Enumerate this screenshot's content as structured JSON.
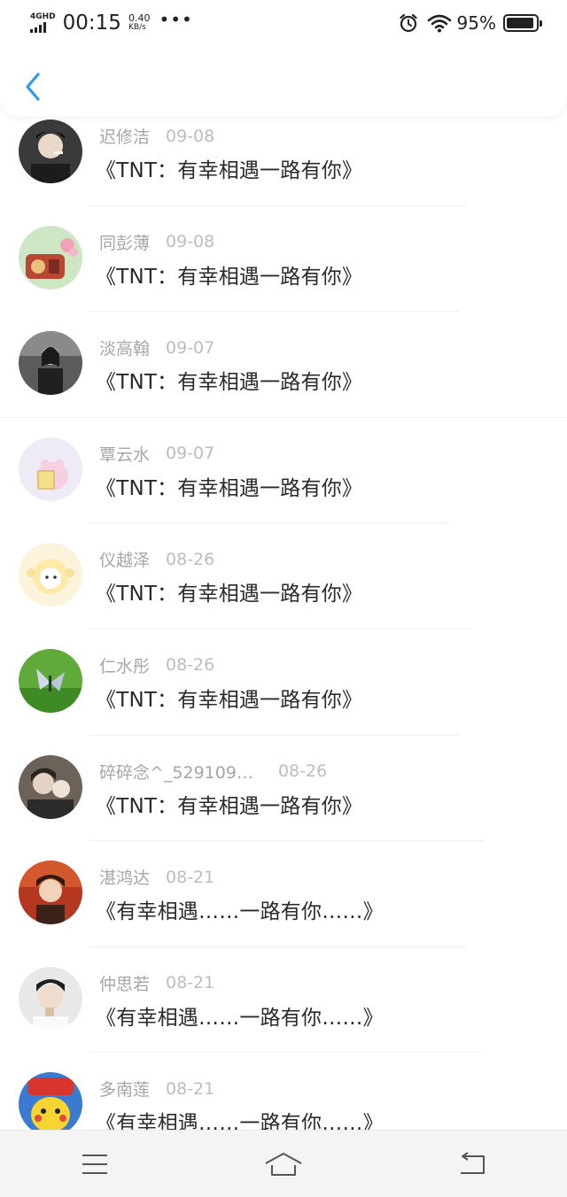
{
  "status_bar": {
    "network": "4GHD",
    "time": "00:15",
    "speed_value": "0.40",
    "speed_unit": "KB/s",
    "more": "•••",
    "battery_percent": "95%",
    "battery_level": 0.95
  },
  "header": {
    "back_icon": "chevron-left-icon",
    "accent_color": "#2b9bf0"
  },
  "list": {
    "items": [
      {
        "user": "迟修洁",
        "date": "09-08",
        "title": "《TNT：有幸相遇一路有你》"
      },
      {
        "user": "同彭薄",
        "date": "09-08",
        "title": "《TNT：有幸相遇一路有你》"
      },
      {
        "user": "淡高翰",
        "date": "09-07",
        "title": "《TNT：有幸相遇一路有你》"
      },
      {
        "user": "覃云水",
        "date": "09-07",
        "title": "《TNT：有幸相遇一路有你》"
      },
      {
        "user": "仪越泽",
        "date": "08-26",
        "title": "《TNT：有幸相遇一路有你》"
      },
      {
        "user": "仁水彤",
        "date": "08-26",
        "title": "《TNT：有幸相遇一路有你》"
      },
      {
        "user": "碎碎念^_529109…",
        "date": "08-26",
        "title": "《TNT：有幸相遇一路有你》"
      },
      {
        "user": "湛鸿达",
        "date": "08-21",
        "title": "《有幸相遇……一路有你……》"
      },
      {
        "user": "仲思若",
        "date": "08-21",
        "title": "《有幸相遇……一路有你……》"
      },
      {
        "user": "多南莲",
        "date": "08-21",
        "title": "《有幸相遇……一路有你……》"
      }
    ]
  },
  "bottom_nav": {
    "menu_icon": "menu-icon",
    "home_icon": "home-icon",
    "back_icon": "return-icon"
  }
}
